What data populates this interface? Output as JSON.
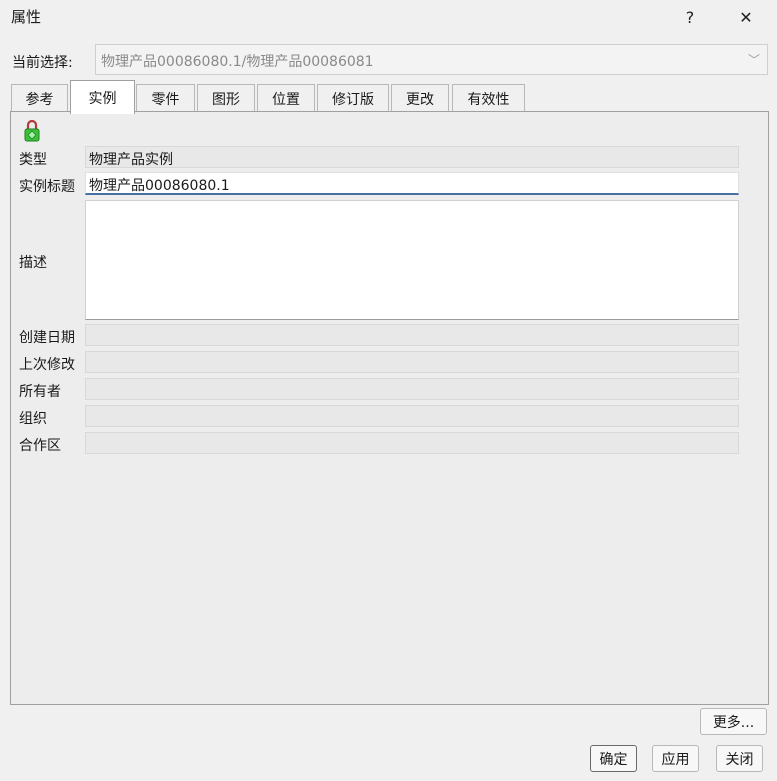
{
  "window": {
    "title": "属性",
    "help_glyph": "?",
    "close_glyph": "✕"
  },
  "selection": {
    "label": "当前选择:",
    "value": "物理产品00086080.1/物理产品00086081",
    "arrow_glyph": "﹀"
  },
  "tabs": [
    {
      "label": "参考"
    },
    {
      "label": "实例",
      "active": true
    },
    {
      "label": "零件"
    },
    {
      "label": "图形"
    },
    {
      "label": "位置"
    },
    {
      "label": "修订版"
    },
    {
      "label": "更改"
    },
    {
      "label": "有效性"
    }
  ],
  "fields": {
    "type_label": "类型",
    "type_value": "物理产品实例",
    "instance_title_label": "实例标题",
    "instance_title_value": "物理产品00086080.1",
    "description_label": "描述",
    "created_label": "创建日期",
    "last_modified_label": "上次修改",
    "owner_label": "所有者",
    "organization_label": "组织",
    "collab_space_label": "合作区"
  },
  "buttons": {
    "more": "更多...",
    "ok": "确定",
    "apply": "应用",
    "close": "关闭"
  },
  "icons": {
    "lock": "lock-icon"
  },
  "colors": {
    "background": "#f0f0f0",
    "panel": "#ededed",
    "input_focus_underline": "#4a6fa5",
    "lock_body": "#3cc13c",
    "lock_shackle": "#b23a3a"
  }
}
